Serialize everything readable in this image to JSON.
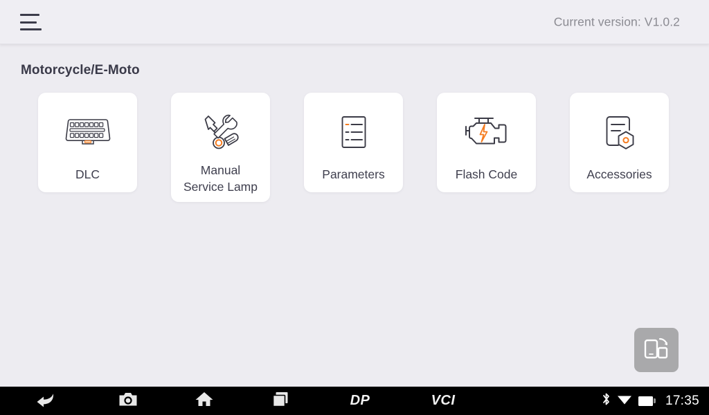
{
  "header": {
    "menu_icon": "hamburger-menu-icon",
    "version_text": "Current version: V1.0.2"
  },
  "main": {
    "section_title": "Motorcycle/E-Moto",
    "cards": [
      {
        "label": "DLC",
        "icon": "obd-connector-icon"
      },
      {
        "label": "Manual\nService Lamp",
        "icon": "wrench-screwdriver-icon"
      },
      {
        "label": "Parameters",
        "icon": "document-list-icon"
      },
      {
        "label": "Flash Code",
        "icon": "check-engine-icon"
      },
      {
        "label": "Accessories",
        "icon": "document-hex-nut-icon"
      }
    ]
  },
  "floating_action": {
    "icon": "screen-rotate-icon",
    "label": "Rotate screen"
  },
  "navbar": {
    "buttons": [
      {
        "name": "back-button",
        "icon": "back-arrow-icon"
      },
      {
        "name": "camera-button",
        "icon": "camera-icon"
      },
      {
        "name": "home-button",
        "icon": "home-icon"
      },
      {
        "name": "recents-button",
        "icon": "recents-icon"
      },
      {
        "name": "dp-button",
        "icon": "dp-logo",
        "label": "DP"
      },
      {
        "name": "vci-button",
        "icon": "vci-logo",
        "label": "VCI"
      }
    ],
    "status": {
      "bluetooth_icon": "bluetooth-icon",
      "wifi_icon": "wifi-icon",
      "battery_icon": "battery-icon",
      "time": "17:35"
    }
  },
  "colors": {
    "background": "#edecf1",
    "header_bg": "#efeef3",
    "card_bg": "#ffffff",
    "accent_orange": "#f57c20",
    "icon_stroke": "#3b3b46",
    "text_primary": "#3f3f4e",
    "text_muted": "#8b8b92",
    "navbar_bg": "#000000",
    "fab_bg": "#a9a9ab"
  }
}
